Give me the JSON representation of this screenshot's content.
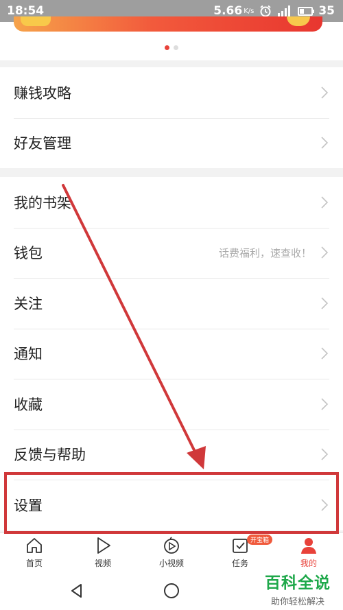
{
  "status_bar": {
    "time": "18:54",
    "network_speed": "5.66",
    "speed_unit": "K/s",
    "battery": "35",
    "battery_level": 0.35
  },
  "banner": {
    "page_count": 2,
    "active_page": 1
  },
  "groups": [
    {
      "items": [
        {
          "label": "赚钱攻略",
          "hint": ""
        },
        {
          "label": "好友管理",
          "hint": ""
        }
      ]
    },
    {
      "items": [
        {
          "label": "我的书架",
          "hint": ""
        },
        {
          "label": "钱包",
          "hint": "话费福利，速查收！"
        },
        {
          "label": "关注",
          "hint": ""
        },
        {
          "label": "通知",
          "hint": ""
        },
        {
          "label": "收藏",
          "hint": ""
        },
        {
          "label": "反馈与帮助",
          "hint": ""
        },
        {
          "label": "设置",
          "hint": ""
        }
      ]
    }
  ],
  "bottom_nav": {
    "items": [
      {
        "label": "首页",
        "icon": "home-icon"
      },
      {
        "label": "视频",
        "icon": "play-icon"
      },
      {
        "label": "小视频",
        "icon": "short-video-icon"
      },
      {
        "label": "任务",
        "icon": "task-icon",
        "badge": "开宝箱"
      },
      {
        "label": "我的",
        "icon": "profile-icon",
        "active": true
      }
    ]
  },
  "watermark": {
    "title": "百科全说",
    "subtitle": "助你轻松解决"
  },
  "colors": {
    "accent": "#e8423a",
    "annotation": "#d0383a"
  }
}
